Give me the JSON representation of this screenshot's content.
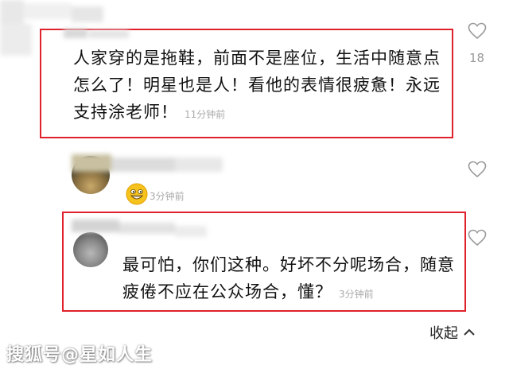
{
  "comments": [
    {
      "text": "人家穿的是拖鞋，前面不是座位，生活中随意点怎么了！明星也是人！看他的表情很疲惫！永远支持涂老师！",
      "time": "11分钟前",
      "likes": "18"
    },
    {
      "emoji": "grinning-emoji",
      "time": "3分钟前"
    },
    {
      "text": "最可怕，你们这种。好坏不分呢场合，随意疲倦不应在公众场合，懂？",
      "time": "3分钟前"
    }
  ],
  "collapse_label": "收起",
  "watermark": "搜狐号@星如人生",
  "colors": {
    "highlight": "#e0202a",
    "time": "#aaaaaa"
  }
}
